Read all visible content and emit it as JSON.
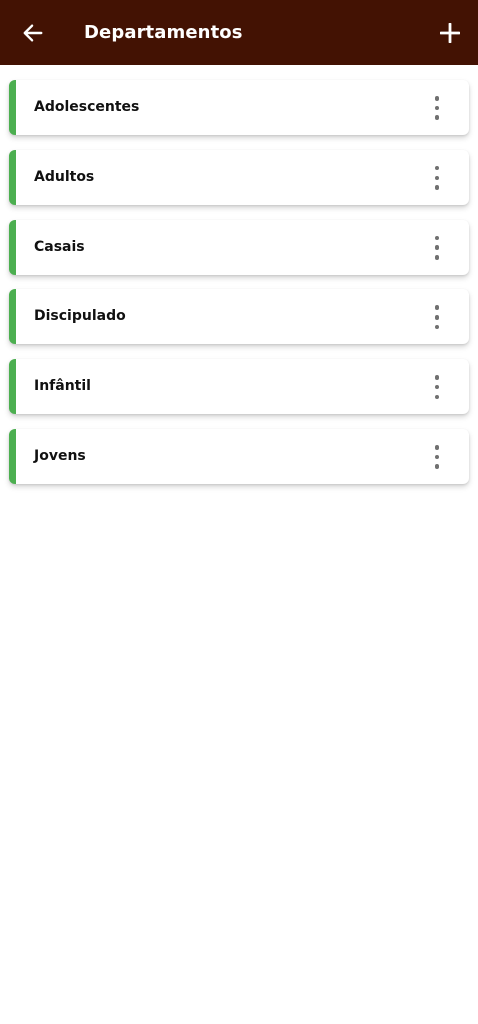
{
  "app_bar": {
    "title": "Departamentos",
    "back_icon": "arrow-left-icon",
    "add_icon": "plus-icon",
    "background_color": "#431203"
  },
  "departments": [
    {
      "label": "Adolescentes"
    },
    {
      "label": "Adultos"
    },
    {
      "label": "Casais"
    },
    {
      "label": "Discipulado"
    },
    {
      "label": "Infântil"
    },
    {
      "label": "Jovens"
    }
  ],
  "item_menu_icon": "more-vertical-icon",
  "accent_color": "#4caf50"
}
